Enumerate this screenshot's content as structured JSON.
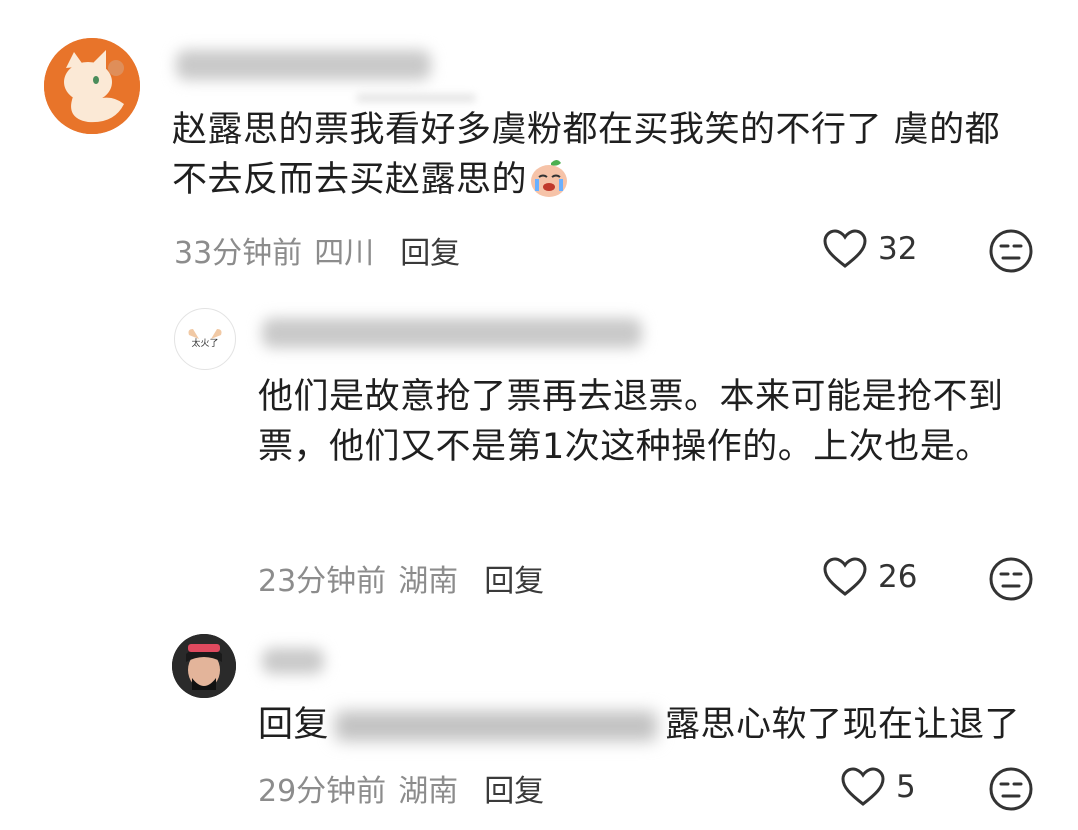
{
  "comments": [
    {
      "text": "赵露思的票我看好多虞粉都在买我笑的不行了 虞的都不去反而去买赵露思的",
      "emoji": "crying-laughing-peach-emoji",
      "time": "33分钟前",
      "location": "四川",
      "reply_label": "回复",
      "likes": "32"
    },
    {
      "avatar_text": "太火了",
      "text": "他们是故意抢了票再去退票。本来可能是抢不到票，他们又不是第1次这种操作的。上次也是。",
      "time": "23分钟前",
      "location": "湖南",
      "reply_label": "回复",
      "likes": "26"
    },
    {
      "reply_prefix": "回复",
      "text_suffix": "露思心软了现在让退了",
      "time": "29分钟前",
      "location": "湖南",
      "reply_label": "回复",
      "likes": "5"
    }
  ],
  "icons": {
    "like": "heart-outline-icon",
    "dislike": "neutral-face-icon"
  },
  "colors": {
    "text": "#1f1f1f",
    "meta": "#8c8c8c",
    "avatar_orange": "#e8742a"
  }
}
